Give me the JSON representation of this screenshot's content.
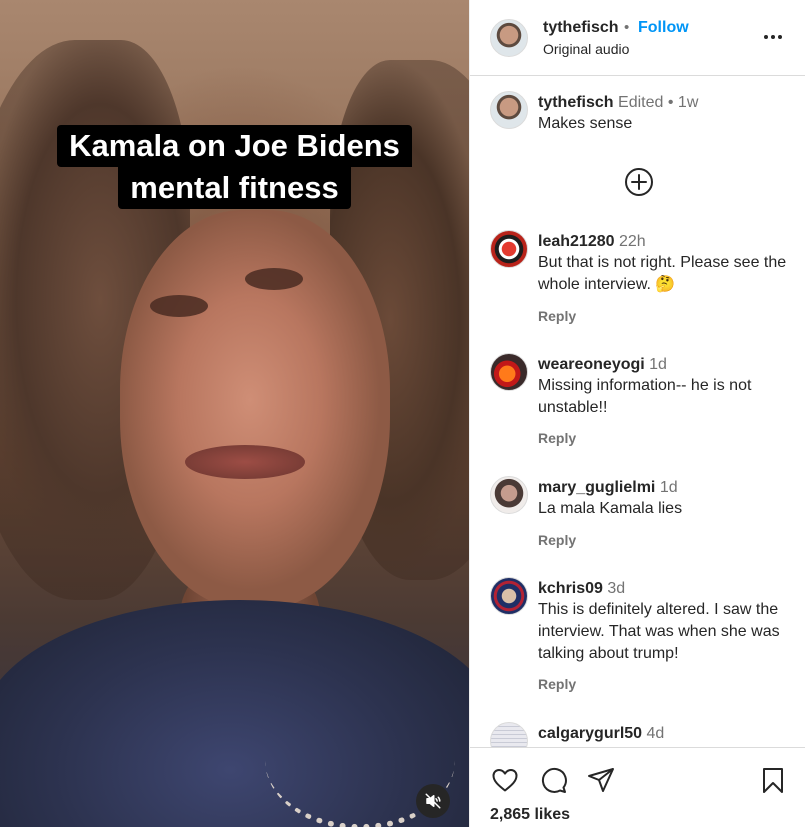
{
  "media": {
    "caption_line1": "Kamala on Joe Bidens",
    "caption_line2": "mental fitness",
    "mute_icon": "speaker-muted-icon"
  },
  "header": {
    "username": "tythefisch",
    "separator": "•",
    "follow_label": "Follow",
    "audio_label": "Original audio",
    "more_icon": "more-horizontal-icon"
  },
  "caption_post": {
    "username": "tythefisch",
    "edited": "Edited",
    "separator": "•",
    "age": "1w",
    "text": "Makes sense",
    "load_more_icon": "plus-circle-icon"
  },
  "comments": [
    {
      "username": "leah21280",
      "age": "22h",
      "text": "But that is not right. Please see the whole interview. 🤔",
      "reply_label": "Reply"
    },
    {
      "username": "weareoneyogi",
      "age": "1d",
      "text": "Missing information-- he is not unstable!!",
      "reply_label": "Reply"
    },
    {
      "username": "mary_guglielmi",
      "age": "1d",
      "text": "La mala Kamala lies",
      "reply_label": "Reply"
    },
    {
      "username": "kchris09",
      "age": "3d",
      "text": "This is definitely altered. I saw the interview. That was when she was talking about trump!",
      "reply_label": "Reply"
    },
    {
      "username": "calgarygurl50",
      "age": "4d",
      "text": "",
      "reply_label": ""
    }
  ],
  "actions": {
    "like_icon": "heart-icon",
    "comment_icon": "comment-icon",
    "share_icon": "send-icon",
    "save_icon": "bookmark-icon",
    "likes_count": "2,865 likes"
  }
}
